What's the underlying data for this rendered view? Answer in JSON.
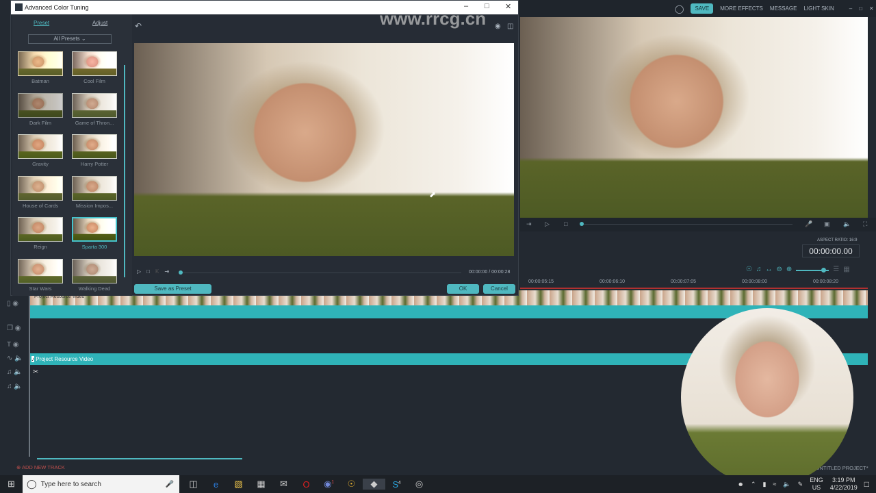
{
  "main_app": {
    "save": "SAVE",
    "more_effects": "MORE EFFECTS",
    "message": "MESSAGE",
    "light_skin": "LIGHT SKIN",
    "aspect_ratio": "ASPECT RATIO: 16:9",
    "timecode": "00:00:00.00",
    "project_name": "UNTITLED PROJECT*",
    "add_new_track": "ADD NEW TRACK",
    "ruler_ticks": [
      "00:00:05:15",
      "00:00:06:10",
      "00:00:07:05",
      "00:00:08:00",
      "00:00:08:20"
    ],
    "audio_clip": "Project Resource Video",
    "video_clip": "Project Resource Video"
  },
  "dialog": {
    "title": "Advanced Color Tuning",
    "tabs": [
      "Preset",
      "Adjust"
    ],
    "preset_filter": "All Presets",
    "presets": [
      "Batman",
      "Cool Film",
      "Dark Film",
      "Game of Thron...",
      "Gravity",
      "Harry Potter",
      "House of Cards",
      "Mission Impos...",
      "Reign",
      "Sparta 300",
      "Star Wars",
      "Walking Dead"
    ],
    "selected_preset": "Sparta 300",
    "time": "00:00:00 / 00:00:28",
    "save_preset": "Save as Preset",
    "ok": "OK",
    "cancel": "Cancel"
  },
  "watermark": "www.rrcg.cn",
  "taskbar": {
    "search_placeholder": "Type here to search",
    "lang": "ENG",
    "region": "US",
    "time": "3:19 PM",
    "date": "4/22/2019",
    "discord_badge": "1",
    "skype_badge": "4"
  },
  "colors": {
    "accent": "#4fb8c0"
  }
}
